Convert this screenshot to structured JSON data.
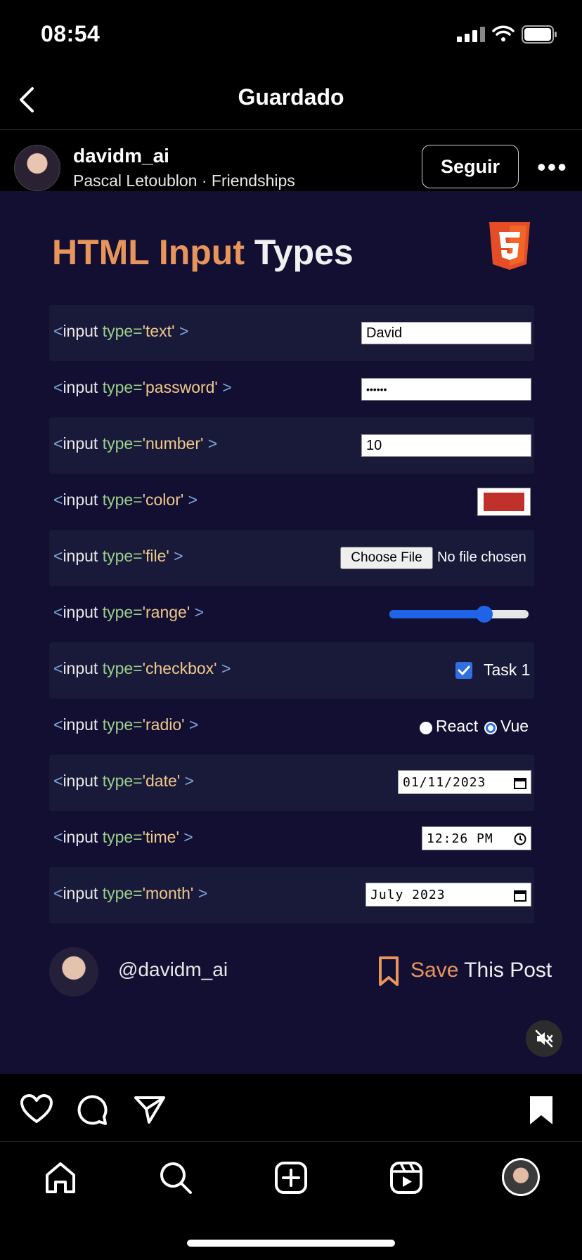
{
  "status_bar": {
    "time": "08:54"
  },
  "nav": {
    "title": "Guardado"
  },
  "post_header": {
    "username": "davidm_ai",
    "subtitle": "Pascal Letoublon · Friendships",
    "follow_label": "Seguir"
  },
  "post_image": {
    "title_orange": "HTML Input ",
    "title_white": "Types",
    "rows": [
      {
        "code_open": "<",
        "code_tag": "input ",
        "code_attr": "type=",
        "code_value": "'text'",
        "code_close": " >",
        "control": "text",
        "value": "David"
      },
      {
        "code_open": "<",
        "code_tag": "input ",
        "code_attr": "type=",
        "code_value": "'password'",
        "code_close": " >",
        "control": "password",
        "value": "••••••"
      },
      {
        "code_open": "<",
        "code_tag": "input ",
        "code_attr": "type=",
        "code_value": "'number'",
        "code_close": " >",
        "control": "number",
        "value": "10"
      },
      {
        "code_open": "<",
        "code_tag": "input ",
        "code_attr": "type=",
        "code_value": "'color'",
        "code_close": " >",
        "control": "color",
        "value": "#c0312b"
      },
      {
        "code_open": "<",
        "code_tag": "input ",
        "code_attr": "type=",
        "code_value": "'file'",
        "code_close": " >",
        "control": "file",
        "button": "Choose File",
        "value": "No file chosen"
      },
      {
        "code_open": "<",
        "code_tag": "input ",
        "code_attr": "type=",
        "code_value": "'range'",
        "code_close": " >",
        "control": "range",
        "level": 0.68
      },
      {
        "code_open": "<",
        "code_tag": "input ",
        "code_attr": "type=",
        "code_value": "'checkbox'",
        "code_close": " >",
        "control": "checkbox",
        "value": "Task 1",
        "checked": true
      },
      {
        "code_open": "<",
        "code_tag": "input ",
        "code_attr": "type=",
        "code_value": "'radio'",
        "code_close": " >",
        "control": "radio",
        "option_1": "React",
        "option_2": "Vue",
        "selected": "Vue"
      },
      {
        "code_open": "<",
        "code_tag": "input ",
        "code_attr": "type=",
        "code_value": "'date'",
        "code_close": " >",
        "control": "date",
        "value": "01/11/2023"
      },
      {
        "code_open": "<",
        "code_tag": "input ",
        "code_attr": "type=",
        "code_value": "'time'",
        "code_close": " >",
        "control": "time",
        "value": "12:26 PM"
      },
      {
        "code_open": "<",
        "code_tag": "input ",
        "code_attr": "type=",
        "code_value": "'month'",
        "code_close": " >",
        "control": "month",
        "value": "July 2023"
      }
    ],
    "footer_handle": "@davidm_ai",
    "save_word": "Save",
    "save_rest": " This Post"
  },
  "colors": {
    "background": "#000000",
    "post_bg": "#120f33",
    "row_bg": "#191a3a",
    "accent_orange": "#e8955c",
    "html5_orange": "#e44d26",
    "checkbox_blue": "#2f6fe0",
    "range_blue": "#1f63e6"
  },
  "icons": [
    "back-chevron-icon",
    "signal-icon",
    "wifi-icon",
    "battery-icon",
    "more-icon",
    "html5-logo-icon",
    "bookmark-outline-icon",
    "mute-icon",
    "heart-icon",
    "comment-icon",
    "share-icon",
    "bookmark-filled-icon",
    "home-icon",
    "search-icon",
    "create-icon",
    "reels-icon",
    "profile-avatar"
  ]
}
